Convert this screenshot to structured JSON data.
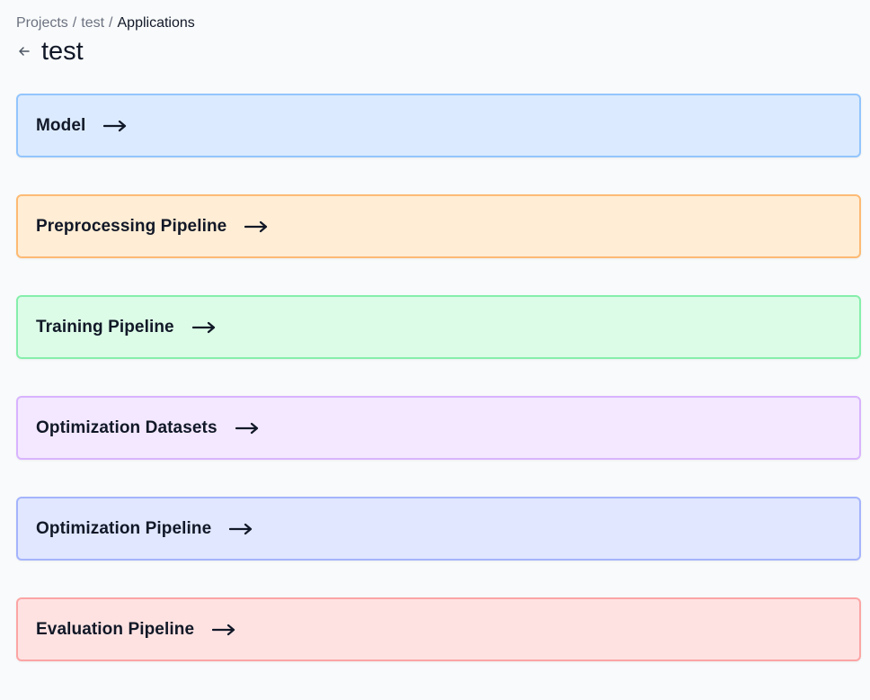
{
  "breadcrumb": {
    "items": [
      "Projects",
      "test",
      "Applications"
    ],
    "separator": "/"
  },
  "header": {
    "back_icon": "arrow-left-icon",
    "title": "test"
  },
  "cards": [
    {
      "label": "Model",
      "icon": "arrow-right-icon",
      "bg": "#dbeafe",
      "border": "#93c5fd"
    },
    {
      "label": "Preprocessing Pipeline",
      "icon": "arrow-right-icon",
      "bg": "#ffedd5",
      "border": "#fdba74"
    },
    {
      "label": "Training Pipeline",
      "icon": "arrow-right-icon",
      "bg": "#dcfce7",
      "border": "#86efac"
    },
    {
      "label": "Optimization Datasets",
      "icon": "arrow-right-icon",
      "bg": "#f3e8ff",
      "border": "#d8b4fe"
    },
    {
      "label": "Optimization Pipeline",
      "icon": "arrow-right-icon",
      "bg": "#e0e7ff",
      "border": "#a5b4fc"
    },
    {
      "label": "Evaluation Pipeline",
      "icon": "arrow-right-icon",
      "bg": "#fee2e2",
      "border": "#fca5a5"
    }
  ]
}
